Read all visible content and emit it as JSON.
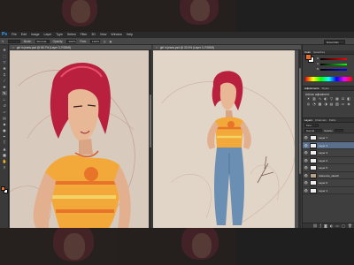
{
  "app": {
    "logo": "Ps",
    "menu": [
      "File",
      "Edit",
      "Image",
      "Layer",
      "Type",
      "Select",
      "Filter",
      "3D",
      "View",
      "Window",
      "Help"
    ],
    "workspace": "Essentials"
  },
  "options_bar": {
    "mode_label": "Mode:",
    "mode_value": "Normal",
    "opacity_label": "Opacity:",
    "opacity_value": "100%",
    "flow_label": "Flow:",
    "flow_value": "100%"
  },
  "documents": [
    {
      "tab": "girl in jeans.psd @ 66.7% (Layer 3, RGB/8)"
    },
    {
      "tab": "girl in jeans.psd @ 33.3% (Layer 3, RGB/8)"
    }
  ],
  "color_panel": {
    "tabs": [
      "Color",
      "Swatches"
    ],
    "foreground": "#e86d2a",
    "background": "#ffffff",
    "channels": [
      "R",
      "G",
      "B"
    ]
  },
  "adjustments_panel": {
    "tabs": [
      "Adjustments",
      "Styles"
    ],
    "title": "Add an adjustment"
  },
  "layers_panel": {
    "tabs": [
      "Layers",
      "Channels",
      "Paths"
    ],
    "filter_label": "Kind",
    "blend_mode": "Normal",
    "opacity_label": "Opacity:",
    "fill_label": "Fill:",
    "layers": [
      {
        "name": "Layer 7",
        "selected": false,
        "image": false
      },
      {
        "name": "Layer 4",
        "selected": true,
        "image": false
      },
      {
        "name": "Layer 3",
        "selected": false,
        "image": false
      },
      {
        "name": "Layer 2",
        "selected": false,
        "image": false
      },
      {
        "name": "Layer 5",
        "selected": false,
        "image": false
      },
      {
        "name": "reference_sketch",
        "selected": false,
        "image": true
      },
      {
        "name": "Layer 6",
        "selected": false,
        "image": false
      },
      {
        "name": "Layer 1",
        "selected": false,
        "image": false
      }
    ]
  },
  "tool_icons": [
    "move-icon",
    "marquee-icon",
    "lasso-icon",
    "quick-select-icon",
    "crop-icon",
    "eyedropper-icon",
    "healing-icon",
    "brush-icon",
    "clone-stamp-icon",
    "history-brush-icon",
    "eraser-icon",
    "gradient-icon",
    "blur-icon",
    "dodge-icon",
    "pen-icon",
    "type-icon",
    "path-select-icon",
    "shape-icon",
    "hand-icon",
    "zoom-icon"
  ]
}
